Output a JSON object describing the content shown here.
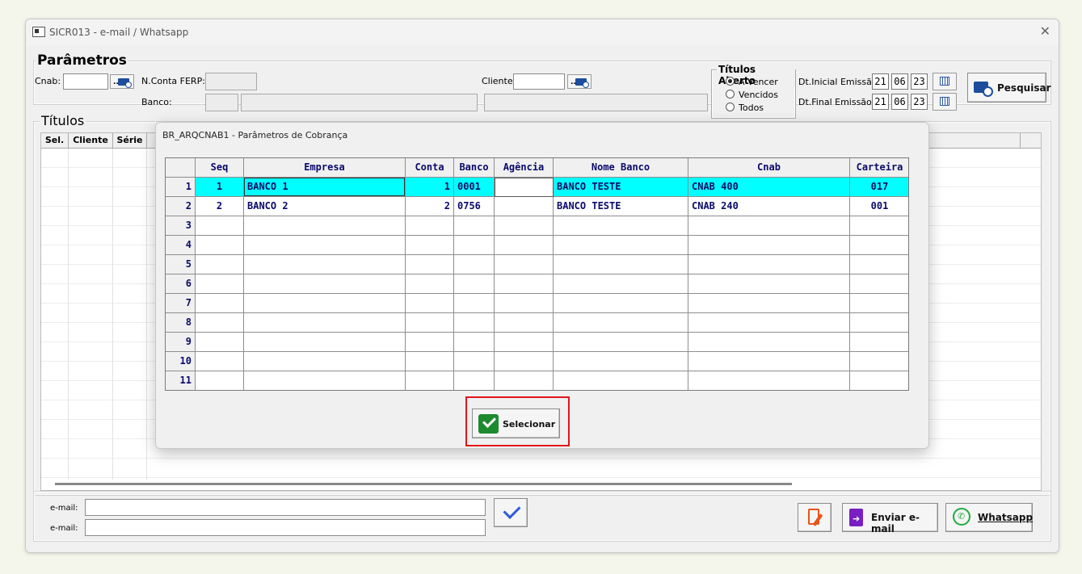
{
  "window": {
    "title": "SICR013 - e-mail / Whatsapp",
    "close_glyph": "✕"
  },
  "parametros": {
    "legend": "Parâmetros",
    "cnab_label": "Cnab:",
    "nconta_label": "N.Conta FERP:",
    "banco_label": "Banco:",
    "cliente_label": "Cliente:",
    "lookup_dots": "..",
    "titulos_aberto": {
      "legend": "Títulos Aberto",
      "options": [
        "A Vencer",
        "Vencidos",
        "Todos"
      ],
      "selected": "A Vencer"
    },
    "dt_inicial_label": "Dt.Inicial Emissão:",
    "dt_final_label": "Dt.Final Emissão:",
    "dt_inicial": {
      "d": "21",
      "m": "06",
      "y": "23"
    },
    "dt_final": {
      "d": "21",
      "m": "06",
      "y": "23"
    },
    "pesquisar_label": "Pesquisar"
  },
  "titulos": {
    "legend": "Títulos",
    "columns": [
      "Sel.",
      "Cliente",
      "Série"
    ]
  },
  "email": {
    "label1": "e-mail:",
    "label2": "e-mail:"
  },
  "actions": {
    "enviar_email": "Enviar e-mail",
    "whatsapp": "Whatsapp"
  },
  "dialog": {
    "title": "BR_ARQCNAB1 - Parâmetros de Cobrança",
    "columns": [
      "Seq",
      "Empresa",
      "Conta",
      "Banco",
      "Agência",
      "Nome Banco",
      "Cnab",
      "Carteira"
    ],
    "row_numbers": [
      "1",
      "2",
      "3",
      "4",
      "5",
      "6",
      "7",
      "8",
      "9",
      "10",
      "11"
    ],
    "rows": [
      {
        "seq": "1",
        "empresa": "BANCO 1",
        "conta": "1",
        "banco": "0001",
        "agencia": "",
        "nome_banco": "BANCO TESTE",
        "cnab": "CNAB 400",
        "carteira": "017"
      },
      {
        "seq": "2",
        "empresa": "BANCO 2",
        "conta": "2",
        "banco": "0756",
        "agencia": "",
        "nome_banco": "BANCO TESTE",
        "cnab": "CNAB 240",
        "carteira": "001"
      }
    ],
    "selected_row": 1,
    "selecionar_label": "Selecionar"
  },
  "colors": {
    "selected_row": "#00ffff",
    "grid_text": "#0a0a6a",
    "highlight": "#e0161b",
    "ok_green": "#1e8a2e",
    "whatsapp": "#1faa3d"
  }
}
